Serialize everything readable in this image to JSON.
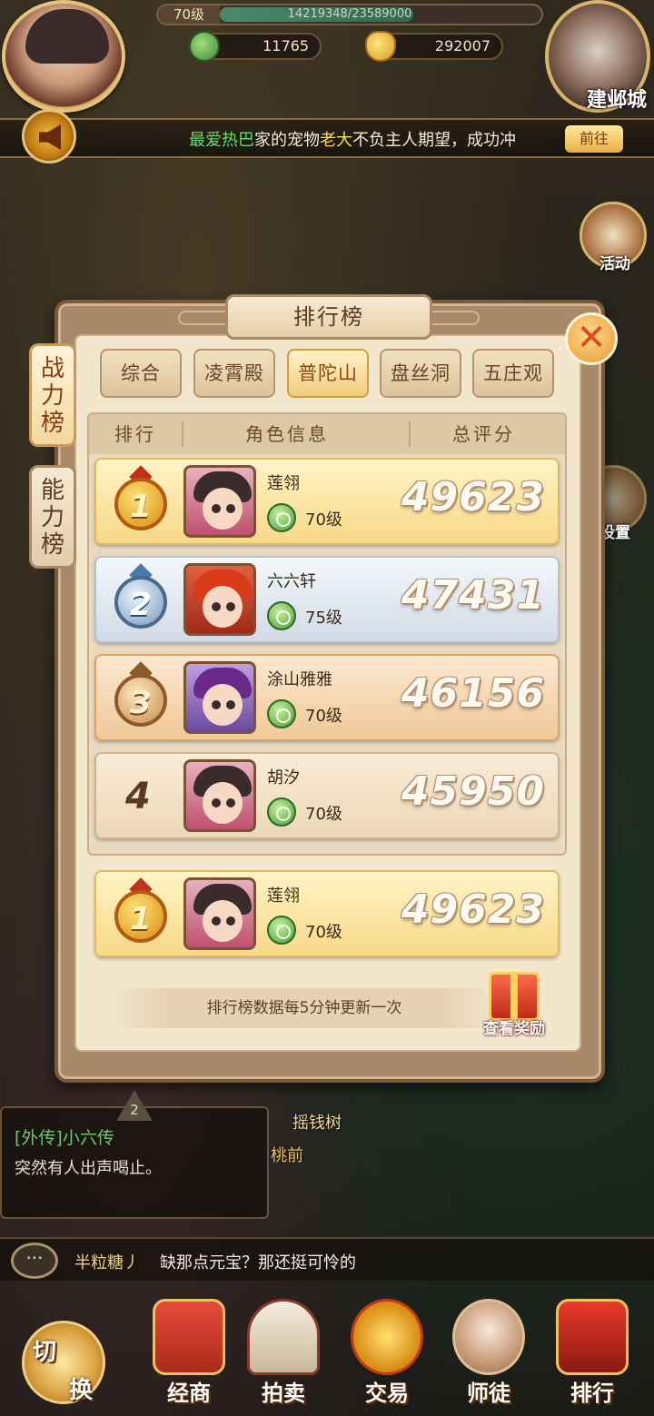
{
  "hud": {
    "level": "70级",
    "exp": "14219348/23589000",
    "exp_ratio": 0.6028,
    "jade_amount": "11765",
    "ingot_amount": "292007",
    "city_label": "建邺城"
  },
  "notice": {
    "part1": "最爱热巴",
    "part2": "家的宠物",
    "part3": "老大",
    "part4": "不负主人期望，成功冲",
    "go_label": "前往"
  },
  "side": {
    "activity_label": "活动",
    "settings_label": "设置"
  },
  "panel": {
    "title": "排行榜",
    "close_glyph": "✕",
    "side_tabs": [
      {
        "label": "战力榜",
        "active": true
      },
      {
        "label": "能力榜",
        "active": false
      }
    ],
    "tabs": [
      {
        "label": "综合",
        "active": false
      },
      {
        "label": "凌霄殿",
        "active": false
      },
      {
        "label": "普陀山",
        "active": true
      },
      {
        "label": "盘丝洞",
        "active": false
      },
      {
        "label": "五庄观",
        "active": false
      }
    ],
    "columns": {
      "rank": "排行",
      "info": "角色信息",
      "score": "总评分"
    },
    "rows": [
      {
        "rank": "1",
        "name": "莲翎",
        "level": "70级",
        "score": "49623",
        "style": "gold",
        "portrait": "girl"
      },
      {
        "rank": "2",
        "name": "六六轩",
        "level": "75级",
        "score": "47431",
        "style": "silver",
        "portrait": "red"
      },
      {
        "rank": "3",
        "name": "涂山雅雅",
        "level": "70级",
        "score": "46156",
        "style": "bronze",
        "portrait": "purple"
      },
      {
        "rank": "4",
        "name": "胡汐",
        "level": "70级",
        "score": "45950",
        "style": "plain",
        "portrait": "girl"
      }
    ],
    "my_row": {
      "rank": "1",
      "name": "莲翎",
      "level": "70级",
      "score": "49623"
    },
    "update_note": "排行榜数据每5分钟更新一次",
    "reward_label": "查看奖励"
  },
  "scene": {
    "dialog_badge": "2",
    "dialog_title": "[外传]小六传",
    "dialog_body": "突然有人出声喝止。",
    "npc_label": "摇钱树",
    "npc_label2": "桃前"
  },
  "chat": {
    "user": "半粒糖丿",
    "message": "缺那点元宝？那还挺可怜的"
  },
  "nav": {
    "switch_top": "切",
    "switch_bottom": "换",
    "items": [
      "经商",
      "拍卖",
      "交易",
      "师徒",
      "排行"
    ]
  }
}
